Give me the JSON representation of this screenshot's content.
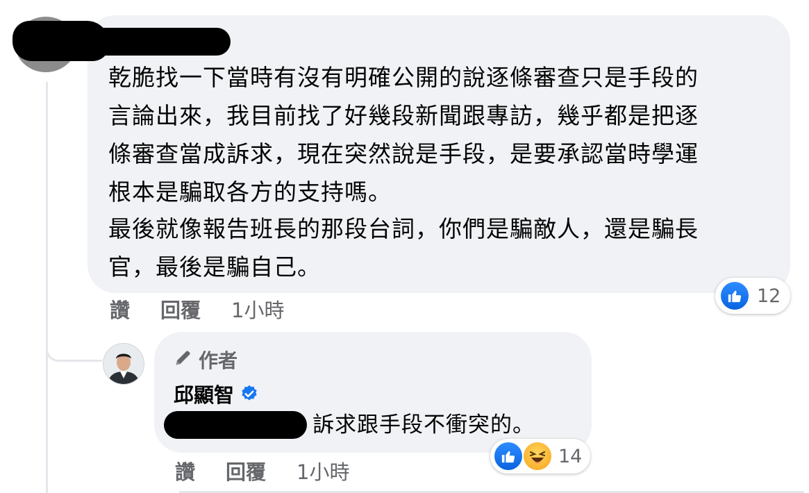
{
  "comment": {
    "paragraphs": [
      "乾脆找一下當時有沒有明確公開的說逐條審查只是手段的\n言論出來，我目前找了好幾段新聞跟專訪，幾乎都是把逐\n條審查當成訴求，現在突然說是手段，是要承認當時學運\n根本是騙取各方的支持嗎。",
      "最後就像報告班長的那段台詞，你們是騙敵人，還是騙長\n官，最後是騙自己。"
    ],
    "reaction_count": "12",
    "reaction_icons": [
      "like-icon"
    ],
    "actions": {
      "like": "讚",
      "reply": "回覆",
      "time": "1小時"
    }
  },
  "reply": {
    "author_badge": "作者",
    "author_badge_icon": "pencil-icon",
    "author_name": "邱顯智",
    "verified_icon": "verified-badge-icon",
    "text": "訴求跟手段不衝突的。",
    "reaction_count": "14",
    "reaction_icons": [
      "like-icon",
      "haha-icon"
    ],
    "actions": {
      "like": "讚",
      "reply": "回覆",
      "time": "1小時"
    }
  },
  "colors": {
    "bubble": "#f0f2f5",
    "meta_text": "#65676b",
    "like_blue": "#1877f2",
    "thread_line": "#e4e6eb"
  }
}
